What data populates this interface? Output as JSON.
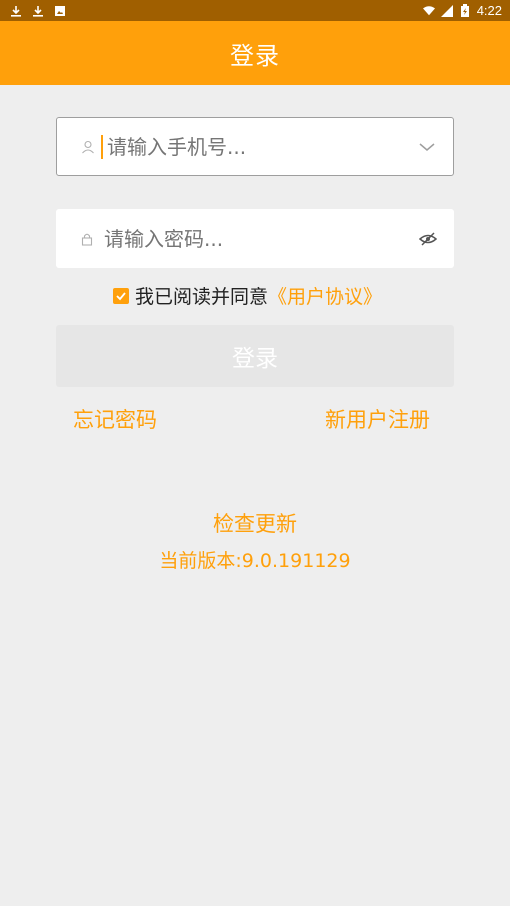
{
  "status_bar": {
    "left_icons": [
      "download-icon",
      "download-icon",
      "image-icon"
    ],
    "right_icons": [
      "wifi-icon",
      "signal-icon",
      "battery-icon"
    ],
    "time": "4:22"
  },
  "app_bar": {
    "title": "登录"
  },
  "phone_field": {
    "placeholder": "请输入手机号...",
    "icon": "user-icon",
    "trailing_icon": "chevron-down-icon"
  },
  "password_field": {
    "placeholder": "请输入密码...",
    "icon": "lock-icon",
    "trailing_icon": "eye-off-icon"
  },
  "agreement": {
    "checked": true,
    "text": "我已阅读并同意",
    "link": "《用户协议》"
  },
  "login_button": {
    "label": "登录"
  },
  "links": {
    "forgot": "忘记密码",
    "register": "新用户注册"
  },
  "update": {
    "check_label": "检查更新",
    "version_text": "当前版本:9.0.191129"
  },
  "colors": {
    "accent": "#ffa00b",
    "status_bar": "#a05f00",
    "background": "#eeeeee"
  }
}
